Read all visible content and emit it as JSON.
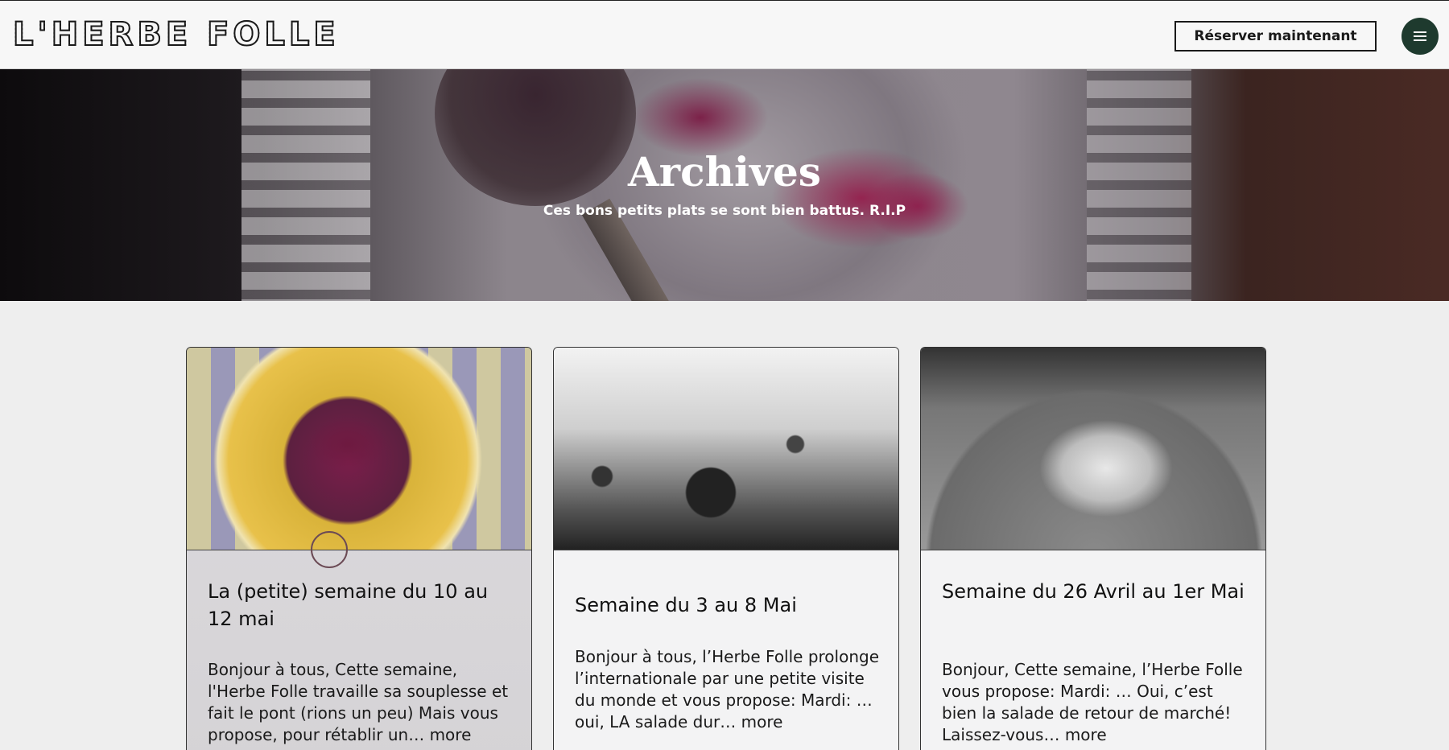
{
  "header": {
    "logo": "L'HERBE FOLLE",
    "reserve_label": "Réserver maintenant",
    "menu_icon": "hamburger-menu-icon",
    "accent_color": "#1e3a2e"
  },
  "hero": {
    "title": "Archives",
    "subtitle": "Ces bons petits plats se sont bien battus. R.I.P"
  },
  "posts": [
    {
      "title": "La (petite) semaine du 10 au 12 mai",
      "excerpt": "Bonjour à tous, Cette semaine, l'Herbe Folle travaille sa souplesse et fait le pont (rions un peu) Mais vous propose, pour rétablir un…",
      "more": "more"
    },
    {
      "title": "Semaine du 3 au 8 Mai",
      "excerpt": "Bonjour à tous, l’Herbe Folle prolonge l’internationale par une petite visite du monde et vous propose: Mardi: …oui, LA salade dur…",
      "more": "more"
    },
    {
      "title": "Semaine du 26 Avril au 1er Mai",
      "excerpt": "Bonjour, Cette semaine, l’Herbe Folle vous propose: Mardi: … Oui, c’est bien la salade de retour de marché! Laissez-vous…",
      "more": "more"
    }
  ]
}
